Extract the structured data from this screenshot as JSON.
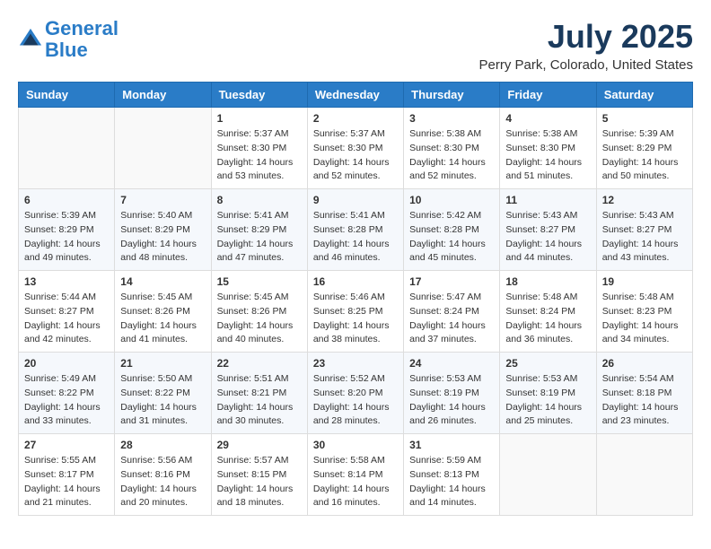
{
  "header": {
    "logo_line1": "General",
    "logo_line2": "Blue",
    "month_year": "July 2025",
    "location": "Perry Park, Colorado, United States"
  },
  "weekdays": [
    "Sunday",
    "Monday",
    "Tuesday",
    "Wednesday",
    "Thursday",
    "Friday",
    "Saturday"
  ],
  "weeks": [
    [
      {
        "day": "",
        "info": ""
      },
      {
        "day": "",
        "info": ""
      },
      {
        "day": "1",
        "info": "Sunrise: 5:37 AM\nSunset: 8:30 PM\nDaylight: 14 hours and 53 minutes."
      },
      {
        "day": "2",
        "info": "Sunrise: 5:37 AM\nSunset: 8:30 PM\nDaylight: 14 hours and 52 minutes."
      },
      {
        "day": "3",
        "info": "Sunrise: 5:38 AM\nSunset: 8:30 PM\nDaylight: 14 hours and 52 minutes."
      },
      {
        "day": "4",
        "info": "Sunrise: 5:38 AM\nSunset: 8:30 PM\nDaylight: 14 hours and 51 minutes."
      },
      {
        "day": "5",
        "info": "Sunrise: 5:39 AM\nSunset: 8:29 PM\nDaylight: 14 hours and 50 minutes."
      }
    ],
    [
      {
        "day": "6",
        "info": "Sunrise: 5:39 AM\nSunset: 8:29 PM\nDaylight: 14 hours and 49 minutes."
      },
      {
        "day": "7",
        "info": "Sunrise: 5:40 AM\nSunset: 8:29 PM\nDaylight: 14 hours and 48 minutes."
      },
      {
        "day": "8",
        "info": "Sunrise: 5:41 AM\nSunset: 8:29 PM\nDaylight: 14 hours and 47 minutes."
      },
      {
        "day": "9",
        "info": "Sunrise: 5:41 AM\nSunset: 8:28 PM\nDaylight: 14 hours and 46 minutes."
      },
      {
        "day": "10",
        "info": "Sunrise: 5:42 AM\nSunset: 8:28 PM\nDaylight: 14 hours and 45 minutes."
      },
      {
        "day": "11",
        "info": "Sunrise: 5:43 AM\nSunset: 8:27 PM\nDaylight: 14 hours and 44 minutes."
      },
      {
        "day": "12",
        "info": "Sunrise: 5:43 AM\nSunset: 8:27 PM\nDaylight: 14 hours and 43 minutes."
      }
    ],
    [
      {
        "day": "13",
        "info": "Sunrise: 5:44 AM\nSunset: 8:27 PM\nDaylight: 14 hours and 42 minutes."
      },
      {
        "day": "14",
        "info": "Sunrise: 5:45 AM\nSunset: 8:26 PM\nDaylight: 14 hours and 41 minutes."
      },
      {
        "day": "15",
        "info": "Sunrise: 5:45 AM\nSunset: 8:26 PM\nDaylight: 14 hours and 40 minutes."
      },
      {
        "day": "16",
        "info": "Sunrise: 5:46 AM\nSunset: 8:25 PM\nDaylight: 14 hours and 38 minutes."
      },
      {
        "day": "17",
        "info": "Sunrise: 5:47 AM\nSunset: 8:24 PM\nDaylight: 14 hours and 37 minutes."
      },
      {
        "day": "18",
        "info": "Sunrise: 5:48 AM\nSunset: 8:24 PM\nDaylight: 14 hours and 36 minutes."
      },
      {
        "day": "19",
        "info": "Sunrise: 5:48 AM\nSunset: 8:23 PM\nDaylight: 14 hours and 34 minutes."
      }
    ],
    [
      {
        "day": "20",
        "info": "Sunrise: 5:49 AM\nSunset: 8:22 PM\nDaylight: 14 hours and 33 minutes."
      },
      {
        "day": "21",
        "info": "Sunrise: 5:50 AM\nSunset: 8:22 PM\nDaylight: 14 hours and 31 minutes."
      },
      {
        "day": "22",
        "info": "Sunrise: 5:51 AM\nSunset: 8:21 PM\nDaylight: 14 hours and 30 minutes."
      },
      {
        "day": "23",
        "info": "Sunrise: 5:52 AM\nSunset: 8:20 PM\nDaylight: 14 hours and 28 minutes."
      },
      {
        "day": "24",
        "info": "Sunrise: 5:53 AM\nSunset: 8:19 PM\nDaylight: 14 hours and 26 minutes."
      },
      {
        "day": "25",
        "info": "Sunrise: 5:53 AM\nSunset: 8:19 PM\nDaylight: 14 hours and 25 minutes."
      },
      {
        "day": "26",
        "info": "Sunrise: 5:54 AM\nSunset: 8:18 PM\nDaylight: 14 hours and 23 minutes."
      }
    ],
    [
      {
        "day": "27",
        "info": "Sunrise: 5:55 AM\nSunset: 8:17 PM\nDaylight: 14 hours and 21 minutes."
      },
      {
        "day": "28",
        "info": "Sunrise: 5:56 AM\nSunset: 8:16 PM\nDaylight: 14 hours and 20 minutes."
      },
      {
        "day": "29",
        "info": "Sunrise: 5:57 AM\nSunset: 8:15 PM\nDaylight: 14 hours and 18 minutes."
      },
      {
        "day": "30",
        "info": "Sunrise: 5:58 AM\nSunset: 8:14 PM\nDaylight: 14 hours and 16 minutes."
      },
      {
        "day": "31",
        "info": "Sunrise: 5:59 AM\nSunset: 8:13 PM\nDaylight: 14 hours and 14 minutes."
      },
      {
        "day": "",
        "info": ""
      },
      {
        "day": "",
        "info": ""
      }
    ]
  ]
}
